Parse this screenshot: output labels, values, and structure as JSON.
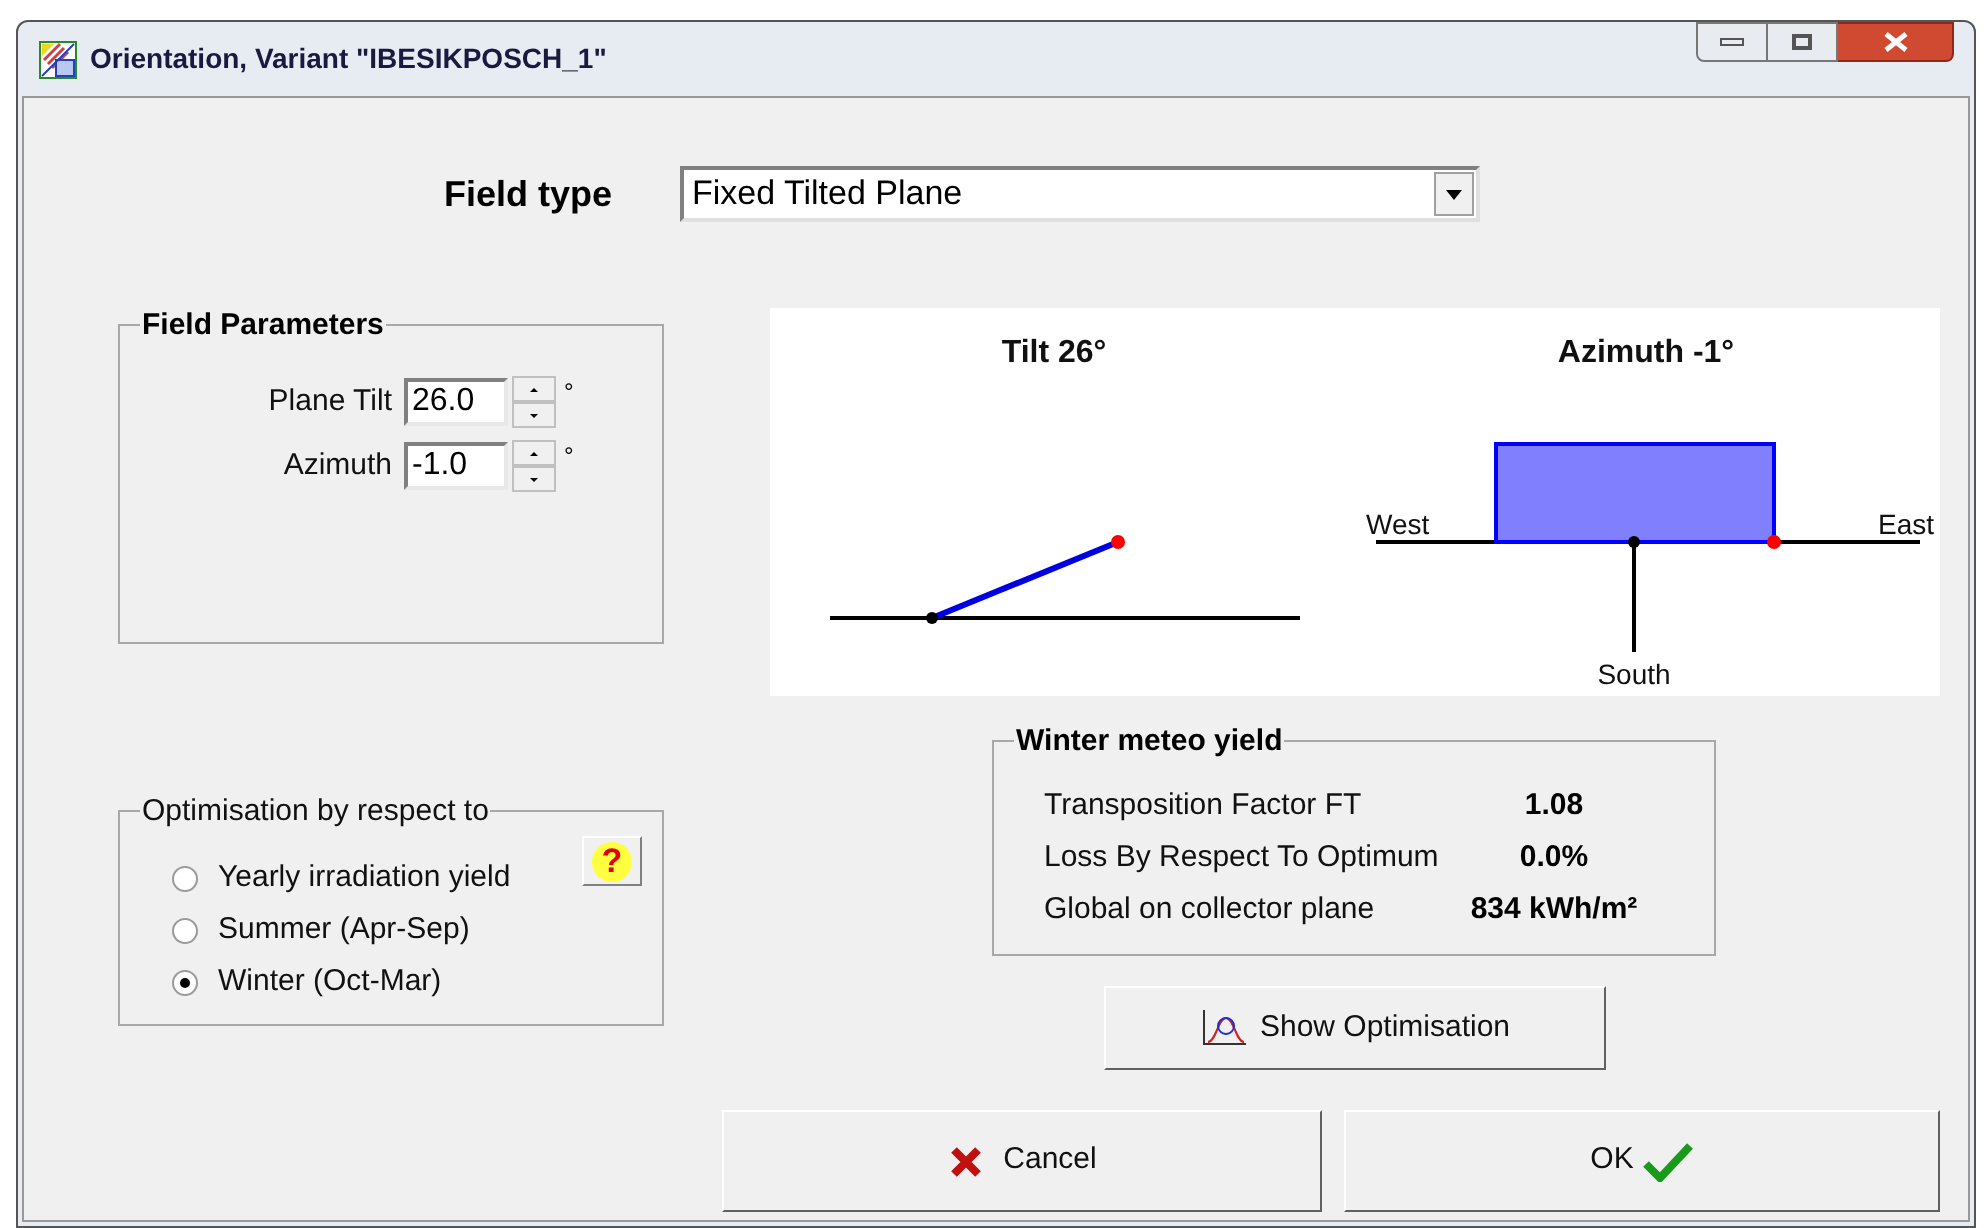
{
  "window": {
    "title": "Orientation, Variant \"IBESIKPOSCH_1\""
  },
  "field_type": {
    "label": "Field type",
    "value": "Fixed Tilted Plane"
  },
  "field_parameters": {
    "title": "Field Parameters",
    "params": [
      {
        "label": "Plane Tilt",
        "value": "26.0",
        "unit": "°"
      },
      {
        "label": "Azimuth",
        "value": "-1.0",
        "unit": "°"
      }
    ]
  },
  "diagram": {
    "tilt_title": "Tilt 26°",
    "azimuth_title": "Azimuth -1°",
    "west": "West",
    "east": "East",
    "south": "South"
  },
  "optimisation": {
    "title": "Optimisation by respect to",
    "help": "?",
    "options": [
      {
        "label": "Yearly irradiation yield",
        "selected": false
      },
      {
        "label": "Summer (Apr-Sep)",
        "selected": false
      },
      {
        "label": "Winter (Oct-Mar)",
        "selected": true
      }
    ]
  },
  "yield": {
    "title": "Winter meteo yield",
    "rows": [
      {
        "label": "Transposition Factor FT",
        "value": "1.08"
      },
      {
        "label": "Loss By Respect To Optimum",
        "value": "0.0%"
      },
      {
        "label": "Global on collector plane",
        "value": "834 kWh/m²"
      }
    ]
  },
  "buttons": {
    "show_optimisation": "Show Optimisation",
    "cancel": "Cancel",
    "ok": "OK"
  }
}
